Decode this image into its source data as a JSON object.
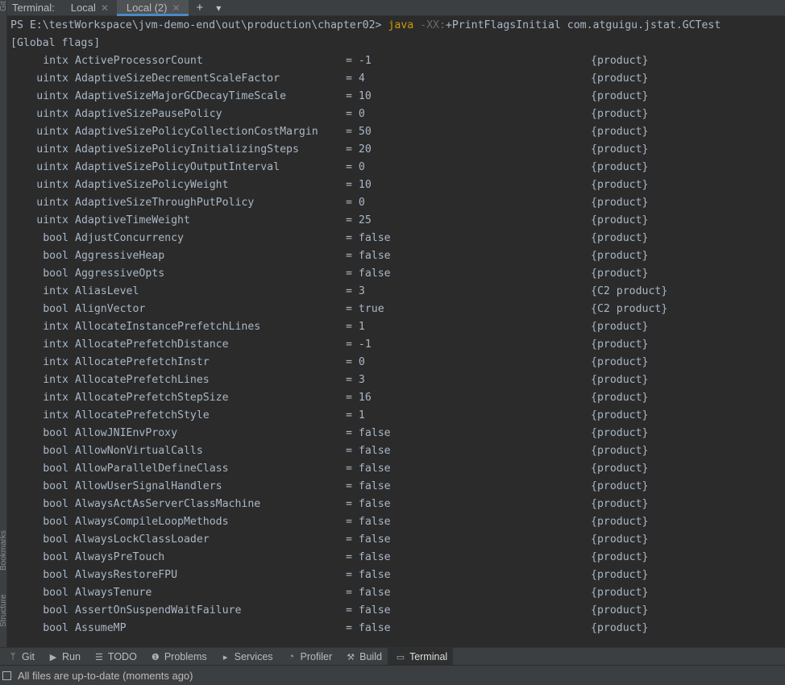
{
  "left_strip": {
    "top_label": "Git",
    "bookmarks_label": "Bookmarks",
    "structure_label": "Structure"
  },
  "tabbar": {
    "title": "Terminal:",
    "tabs": [
      {
        "label": "Local"
      },
      {
        "label": "Local (2)",
        "active": true
      }
    ],
    "add_icon": "plus-icon",
    "more_icon": "chevron-down-icon"
  },
  "terminal": {
    "prompt": "PS E:\\testWorkspace\\jvm-demo-end\\out\\production\\chapter02> ",
    "command_java": "java",
    "command_flag_prefix": " -XX:",
    "command_rest": "+PrintFlagsInitial com.atguigu.jstat.GCTest",
    "section_header": "[Global flags]",
    "flags": [
      {
        "type": "intx",
        "name": "ActiveProcessorCount",
        "value": "= -1",
        "kind": "{product}"
      },
      {
        "type": "uintx",
        "name": "AdaptiveSizeDecrementScaleFactor",
        "value": "= 4",
        "kind": "{product}"
      },
      {
        "type": "uintx",
        "name": "AdaptiveSizeMajorGCDecayTimeScale",
        "value": "= 10",
        "kind": "{product}"
      },
      {
        "type": "uintx",
        "name": "AdaptiveSizePausePolicy",
        "value": "= 0",
        "kind": "{product}"
      },
      {
        "type": "uintx",
        "name": "AdaptiveSizePolicyCollectionCostMargin",
        "value": "= 50",
        "kind": "{product}"
      },
      {
        "type": "uintx",
        "name": "AdaptiveSizePolicyInitializingSteps",
        "value": "= 20",
        "kind": "{product}"
      },
      {
        "type": "uintx",
        "name": "AdaptiveSizePolicyOutputInterval",
        "value": "= 0",
        "kind": "{product}"
      },
      {
        "type": "uintx",
        "name": "AdaptiveSizePolicyWeight",
        "value": "= 10",
        "kind": "{product}"
      },
      {
        "type": "uintx",
        "name": "AdaptiveSizeThroughPutPolicy",
        "value": "= 0",
        "kind": "{product}"
      },
      {
        "type": "uintx",
        "name": "AdaptiveTimeWeight",
        "value": "= 25",
        "kind": "{product}"
      },
      {
        "type": "bool",
        "name": "AdjustConcurrency",
        "value": "= false",
        "kind": "{product}"
      },
      {
        "type": "bool",
        "name": "AggressiveHeap",
        "value": "= false",
        "kind": "{product}"
      },
      {
        "type": "bool",
        "name": "AggressiveOpts",
        "value": "= false",
        "kind": "{product}"
      },
      {
        "type": "intx",
        "name": "AliasLevel",
        "value": "= 3",
        "kind": "{C2 product}"
      },
      {
        "type": "bool",
        "name": "AlignVector",
        "value": "= true",
        "kind": "{C2 product}"
      },
      {
        "type": "intx",
        "name": "AllocateInstancePrefetchLines",
        "value": "= 1",
        "kind": "{product}"
      },
      {
        "type": "intx",
        "name": "AllocatePrefetchDistance",
        "value": "= -1",
        "kind": "{product}"
      },
      {
        "type": "intx",
        "name": "AllocatePrefetchInstr",
        "value": "= 0",
        "kind": "{product}"
      },
      {
        "type": "intx",
        "name": "AllocatePrefetchLines",
        "value": "= 3",
        "kind": "{product}"
      },
      {
        "type": "intx",
        "name": "AllocatePrefetchStepSize",
        "value": "= 16",
        "kind": "{product}"
      },
      {
        "type": "intx",
        "name": "AllocatePrefetchStyle",
        "value": "= 1",
        "kind": "{product}"
      },
      {
        "type": "bool",
        "name": "AllowJNIEnvProxy",
        "value": "= false",
        "kind": "{product}"
      },
      {
        "type": "bool",
        "name": "AllowNonVirtualCalls",
        "value": "= false",
        "kind": "{product}"
      },
      {
        "type": "bool",
        "name": "AllowParallelDefineClass",
        "value": "= false",
        "kind": "{product}"
      },
      {
        "type": "bool",
        "name": "AllowUserSignalHandlers",
        "value": "= false",
        "kind": "{product}"
      },
      {
        "type": "bool",
        "name": "AlwaysActAsServerClassMachine",
        "value": "= false",
        "kind": "{product}"
      },
      {
        "type": "bool",
        "name": "AlwaysCompileLoopMethods",
        "value": "= false",
        "kind": "{product}"
      },
      {
        "type": "bool",
        "name": "AlwaysLockClassLoader",
        "value": "= false",
        "kind": "{product}"
      },
      {
        "type": "bool",
        "name": "AlwaysPreTouch",
        "value": "= false",
        "kind": "{product}"
      },
      {
        "type": "bool",
        "name": "AlwaysRestoreFPU",
        "value": "= false",
        "kind": "{product}"
      },
      {
        "type": "bool",
        "name": "AlwaysTenure",
        "value": "= false",
        "kind": "{product}"
      },
      {
        "type": "bool",
        "name": "AssertOnSuspendWaitFailure",
        "value": "= false",
        "kind": "{product}"
      },
      {
        "type": "bool",
        "name": "AssumeMP",
        "value": "= false",
        "kind": "{product}"
      }
    ]
  },
  "tool_windows": [
    {
      "label": "Git",
      "icon": "git-branch-icon"
    },
    {
      "label": "Run",
      "icon": "run-icon"
    },
    {
      "label": "TODO",
      "icon": "todo-list-icon"
    },
    {
      "label": "Problems",
      "icon": "problems-icon"
    },
    {
      "label": "Services",
      "icon": "services-icon"
    },
    {
      "label": "Profiler",
      "icon": "profiler-icon"
    },
    {
      "label": "Build",
      "icon": "build-hammer-icon"
    },
    {
      "label": "Terminal",
      "icon": "terminal-icon",
      "active": true
    }
  ],
  "status_bar": {
    "message": "All files are up-to-date (moments ago)"
  },
  "colors": {
    "background": "#2b2b2b",
    "panel": "#3c3f41",
    "text": "#a9b7c6",
    "java_keyword": "#cc9a06",
    "flag_prefix": "#676b6e",
    "active_tab_underline": "#4a88c7"
  }
}
